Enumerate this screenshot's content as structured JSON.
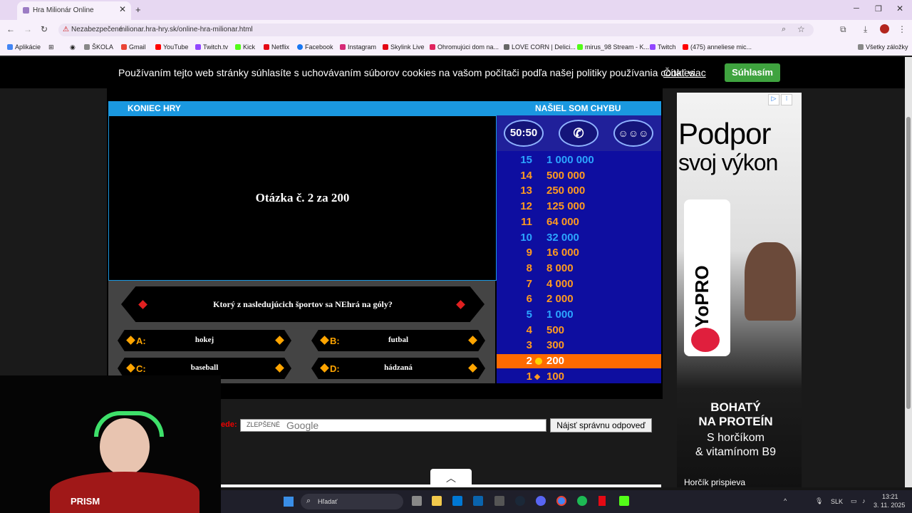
{
  "browser": {
    "tab_title": "Hra Milionár Online",
    "security_label": "Nezabezpečené",
    "url": "milionar.hra-hry.sk/online-hra-milionar.html",
    "bookmarks": [
      "Aplikácie",
      "ŠKOLA",
      "Gmail",
      "YouTube",
      "Twitch.tv",
      "Kick",
      "Netflix",
      "Facebook",
      "Instagram",
      "Skylink Live",
      "Ohromujúci dom na...",
      "LOVE CORN | Delici...",
      "mirus_98 Stream - K...",
      "Twitch",
      "(475) anneliese mic..."
    ],
    "all_bookmarks": "Všetky záložky"
  },
  "cookie": {
    "text": "Používaním tejto web stránky súhlasíte s uchovávaním súborov cookies na vašom počítači podľa našej politiky používania cookies.",
    "link": "Čítať viac",
    "button": "Súhlasím"
  },
  "game": {
    "end_game": "KONIEC HRY",
    "report_bug": "NAŠIEL SOM CHYBU",
    "question_header": "Otázka č. 2 za 200",
    "question": "Ktorý z nasledujúcich športov sa NEhrá na góly?",
    "answers": [
      {
        "letter": "A:",
        "text": "hokej"
      },
      {
        "letter": "B:",
        "text": "futbal"
      },
      {
        "letter": "C:",
        "text": "baseball"
      },
      {
        "letter": "D:",
        "text": "hádzaná"
      }
    ],
    "lifelines": [
      "50:50",
      "phone-icon",
      "audience-icon"
    ],
    "prizes": [
      {
        "n": "15",
        "v": "1 000 000"
      },
      {
        "n": "14",
        "v": "500 000"
      },
      {
        "n": "13",
        "v": "250 000"
      },
      {
        "n": "12",
        "v": "125 000"
      },
      {
        "n": "11",
        "v": "64 000"
      },
      {
        "n": "10",
        "v": "32 000"
      },
      {
        "n": "9",
        "v": "16 000"
      },
      {
        "n": "8",
        "v": "8 000"
      },
      {
        "n": "7",
        "v": "4 000"
      },
      {
        "n": "6",
        "v": "2 000"
      },
      {
        "n": "5",
        "v": "1 000"
      },
      {
        "n": "4",
        "v": "500"
      },
      {
        "n": "3",
        "v": "300"
      },
      {
        "n": "2",
        "v": "200"
      },
      {
        "n": "1",
        "v": "100"
      }
    ],
    "current_level": "2"
  },
  "search": {
    "label": "ede:",
    "enhanced": "ZLEPŠENÉ",
    "google": "Google",
    "button": "Nájsť správnu odpoveď"
  },
  "ad": {
    "line1": "Podpor",
    "line2": "svoj výkon",
    "brand": "YoPRO",
    "bottom1": "BOHATÝ",
    "bottom2": "NA PROTEÍN",
    "bottom3": "S horčíkom",
    "bottom4": "& vitamínom B9",
    "footer": "Horčík prispieva"
  },
  "webcam": {
    "caption": "PRISM"
  },
  "taskbar": {
    "search": "Hľadať",
    "lang": "SLK",
    "time": "13:21",
    "date": "3. 11. 2025"
  }
}
